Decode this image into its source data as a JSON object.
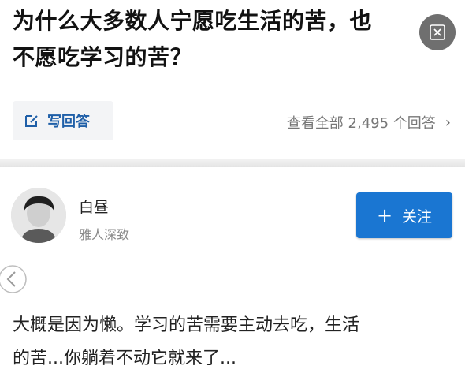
{
  "question": {
    "title_line1": "为什么大多数人宁愿吃生活的苦，也",
    "title_line2": "不愿吃学习的苦？"
  },
  "close": {
    "icon": "close-icon"
  },
  "action_bar": {
    "write_answer_label": "写回答",
    "write_icon": "edit-icon",
    "view_all_label": "查看全部 2,495 个回答",
    "chevron": "›"
  },
  "author": {
    "name": "白昼",
    "bio": "雅人深致"
  },
  "follow": {
    "plus": "+",
    "label": "关注"
  },
  "answer": {
    "line1": "大概是因为懒。学习的苦需要主动去吃，生活",
    "line2": "的苦...你躺着不动它就来了..."
  },
  "colors": {
    "accent": "#1a76d2",
    "link": "#1f5fa8",
    "muted": "#8a8a8a"
  }
}
